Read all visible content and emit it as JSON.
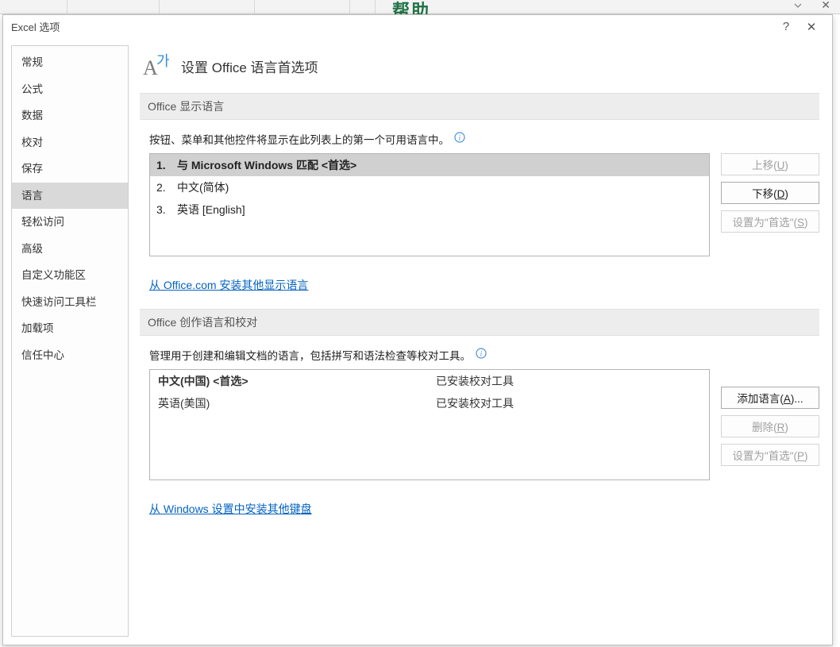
{
  "bg": {
    "help_fragment": "帮助"
  },
  "dialog": {
    "title": "Excel 选项"
  },
  "sidebar": {
    "items": [
      {
        "label": "常规"
      },
      {
        "label": "公式"
      },
      {
        "label": "数据"
      },
      {
        "label": "校对"
      },
      {
        "label": "保存"
      },
      {
        "label": "语言"
      },
      {
        "label": "轻松访问"
      },
      {
        "label": "高级"
      },
      {
        "label": "自定义功能区"
      },
      {
        "label": "快速访问工具栏"
      },
      {
        "label": "加载项"
      },
      {
        "label": "信任中心"
      }
    ],
    "active_index": 5
  },
  "page": {
    "title": "设置 Office 语言首选项"
  },
  "display_section": {
    "header": "Office 显示语言",
    "desc": "按钮、菜单和其他控件将显示在此列表上的第一个可用语言中。",
    "items": [
      {
        "num": "1.",
        "text": "与 Microsoft Windows 匹配 <首选>"
      },
      {
        "num": "2.",
        "text": "中文(简体)"
      },
      {
        "num": "3.",
        "text": "英语 [English]"
      }
    ],
    "selected_index": 0,
    "buttons": {
      "up": "上移(U)",
      "down": "下移(D)",
      "preferred": "设置为\"首选\"(S)"
    },
    "link": "从 Office.com 安装其他显示语言"
  },
  "author_section": {
    "header": "Office 创作语言和校对",
    "desc": "管理用于创建和编辑文档的语言，包括拼写和语法检查等校对工具。",
    "items": [
      {
        "lang": "中文(中国) <首选>",
        "status": "已安装校对工具",
        "preferred": true
      },
      {
        "lang": "英语(美国)",
        "status": "已安装校对工具",
        "preferred": false
      }
    ],
    "buttons": {
      "add": "添加语言(A)...",
      "remove": "删除(R)",
      "preferred": "设置为\"首选\"(P)"
    },
    "link": "从 Windows 设置中安装其他键盘"
  }
}
